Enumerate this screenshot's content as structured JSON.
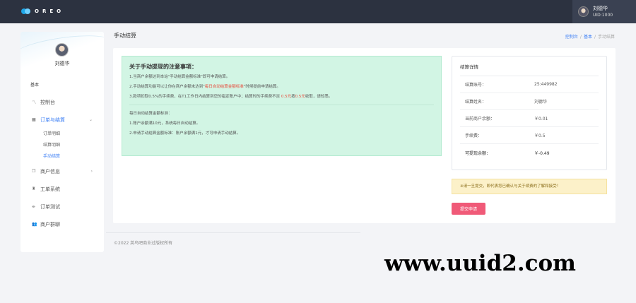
{
  "app": {
    "logo_text": "OREO"
  },
  "user": {
    "name": "刘德华",
    "uid": "UID:1000"
  },
  "sidebar": {
    "name": "刘德华",
    "section": "基本",
    "items": [
      {
        "label": "控制台",
        "icon": "dashboard-icon"
      },
      {
        "label": "订单与结算",
        "icon": "grid-icon",
        "sub": [
          "订单明细",
          "结算明细",
          "手动结算"
        ]
      },
      {
        "label": "商户信息",
        "icon": "document-icon"
      },
      {
        "label": "工单系统",
        "icon": "ticket-icon"
      },
      {
        "label": "订单测试",
        "icon": "test-icon"
      },
      {
        "label": "商户群聊",
        "icon": "group-icon"
      }
    ]
  },
  "header": {
    "title": "手动结算",
    "breadcrumb": [
      "控制台",
      "基本",
      "手动结算"
    ]
  },
  "notice": {
    "title": "关于手动提现的注意事项：",
    "line1": "1.当商户余额达到本站\"手动结算金额标准\"即可申请结算。",
    "line2_pre": "2.手动结算功能可以让你在商户余额未达到\"",
    "line2_red": "每日自动结算金额标准",
    "line2_post": "\"时候提前申请结算。",
    "line3_pre": "3.款项扣取0.5%的手续费，在T1工作日内结算到您的指定账户中；结算时的手续费不足",
    "line3_red1": "0.5元",
    "line3_mid": "按",
    "line3_red2": "0.5元",
    "line3_post": "收取，请知悉。",
    "standard_title": "每日自动结算金额标准：",
    "standard1": "1.账户余额满10元，系统每日自动结算。",
    "standard2": "2.申请手动结算金额标准：账户余额满1元，才可申请手动结算。"
  },
  "details": {
    "title": "结算详情",
    "rows": [
      {
        "label": "结算账号：",
        "value": "25:449982"
      },
      {
        "label": "结算姓名：",
        "value": "刘德华"
      },
      {
        "label": "当前商户余额：",
        "value": "￥0.01"
      },
      {
        "label": "手续费：",
        "value": "￥0.5"
      },
      {
        "label": "可提现余额：",
        "value": "￥-0.49"
      }
    ]
  },
  "warning": "※请一旦提交，即代表您已确认与关于续费的了解和接受！",
  "submit_label": "提交申请",
  "footer": "©2022 英鸟吧商业过版权所有",
  "watermark": "www.uuid2.com",
  "colors": {
    "topbar": "#2c3240",
    "accent": "#3d7ff5",
    "notice_bg": "#d2f5e4",
    "submit": "#f05a78",
    "warn_bg": "#fcf1c9"
  }
}
